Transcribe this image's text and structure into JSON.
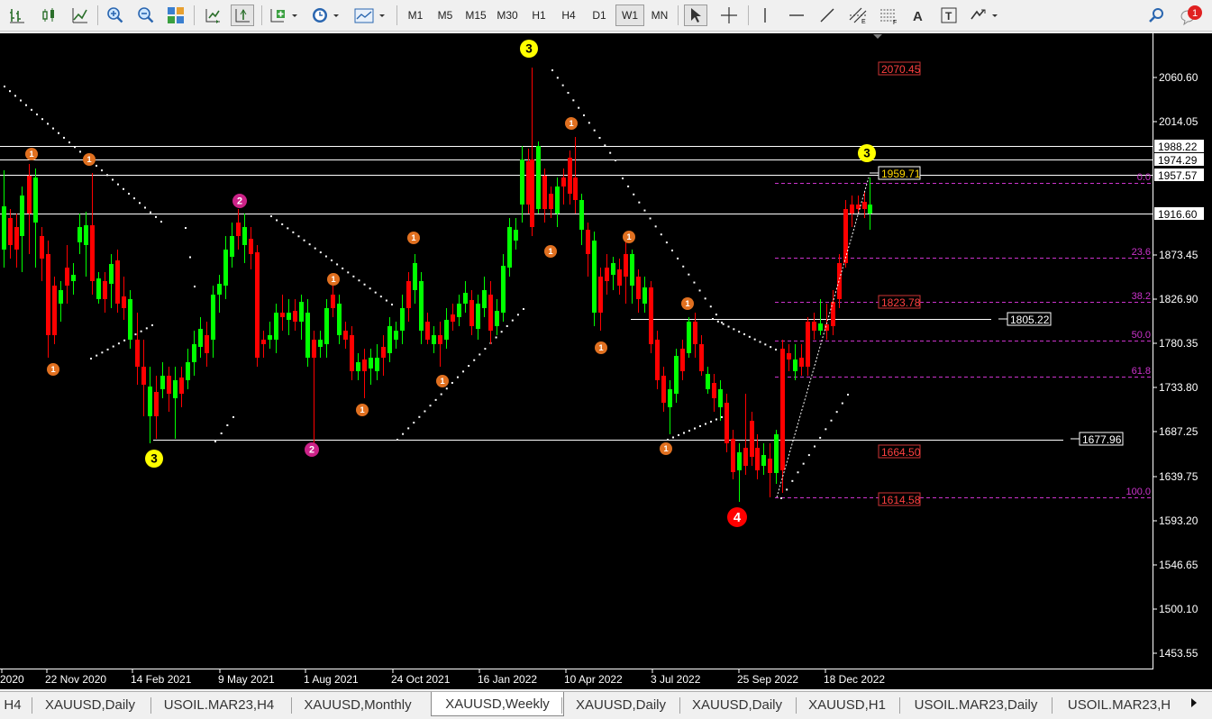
{
  "toolbar": {
    "timeframes": [
      "M1",
      "M5",
      "M15",
      "M30",
      "H1",
      "H4",
      "D1",
      "W1",
      "MN"
    ],
    "active_timeframe": "W1",
    "notification_count": "1",
    "icons": [
      "bar-chart-icon",
      "candlestick-icon",
      "line-chart-icon",
      "zoom-in-icon",
      "zoom-out-icon",
      "tile-windows-icon",
      "autoscroll-icon",
      "chart-shift-icon",
      "indicators-icon",
      "periods-icon",
      "templates-icon",
      "cursor-icon",
      "crosshair-icon",
      "vertical-line-icon",
      "horizontal-line-icon",
      "trendline-icon",
      "channel-icon",
      "fibonacci-icon",
      "text-icon",
      "text-label-icon",
      "arrows-icon",
      "search-icon",
      "notification-icon"
    ]
  },
  "chart": {
    "symbol": "XAUUSD",
    "timeframe": "Weekly",
    "price_axis": [
      "2060.60",
      "2014.05",
      "1873.45",
      "1826.90",
      "1780.35",
      "1733.80",
      "1687.25",
      "1639.75",
      "1593.20",
      "1546.65",
      "1500.10",
      "1453.55"
    ],
    "price_labels": [
      {
        "text": "1988.22",
        "color": "#ffffff",
        "fg": "#000000"
      },
      {
        "text": "1974.29",
        "color": "#ffffff",
        "fg": "#000000"
      },
      {
        "text": "1957.57",
        "color": "#ffffff",
        "fg": "#000000"
      },
      {
        "text": "1916.60",
        "color": "#ffffff",
        "fg": "#000000"
      }
    ],
    "time_axis": [
      "2020",
      "22 Nov 2020",
      "14 Feb 2021",
      "9 May 2021",
      "1 Aug 2021",
      "24 Oct 2021",
      "16 Jan 2022",
      "10 Apr 2022",
      "3 Jul 2022",
      "25 Sep 2022",
      "18 Dec 2022"
    ],
    "fib_levels": [
      {
        "label": "0.0",
        "price": "1959.71"
      },
      {
        "label": "23.6",
        "price": ""
      },
      {
        "label": "38.2",
        "price": "1823.78"
      },
      {
        "label": "50.0",
        "price": ""
      },
      {
        "label": "61.8",
        "price": ""
      },
      {
        "label": "100.0",
        "price": "1614.58"
      }
    ],
    "extra_price_tags": [
      "2070.45",
      "1664.50"
    ],
    "line_tags": [
      "1805.22",
      "1677.96"
    ],
    "wave_labels": {
      "w1": "1",
      "w2": "2",
      "w3": "3",
      "w4": "4"
    },
    "colors": {
      "bull": "#00ff00",
      "bear": "#ff0000",
      "fib": "#cc33cc",
      "wave1": "#e07020",
      "wave2": "#cc2288",
      "wave3": "#ffff00",
      "wave4": "#ff0000"
    }
  },
  "tabs": [
    {
      "label": "H4"
    },
    {
      "label": "XAUUSD,Daily"
    },
    {
      "label": "USOIL.MAR23,H4"
    },
    {
      "label": "XAUUSD,Monthly"
    },
    {
      "label": "XAUUSD,Weekly",
      "active": true
    },
    {
      "label": "XAUUSD,Daily"
    },
    {
      "label": "XAUUSD,Daily"
    },
    {
      "label": "XAUUSD,H1"
    },
    {
      "label": "USOIL.MAR23,Daily"
    },
    {
      "label": "USOIL.MAR23,H"
    }
  ]
}
